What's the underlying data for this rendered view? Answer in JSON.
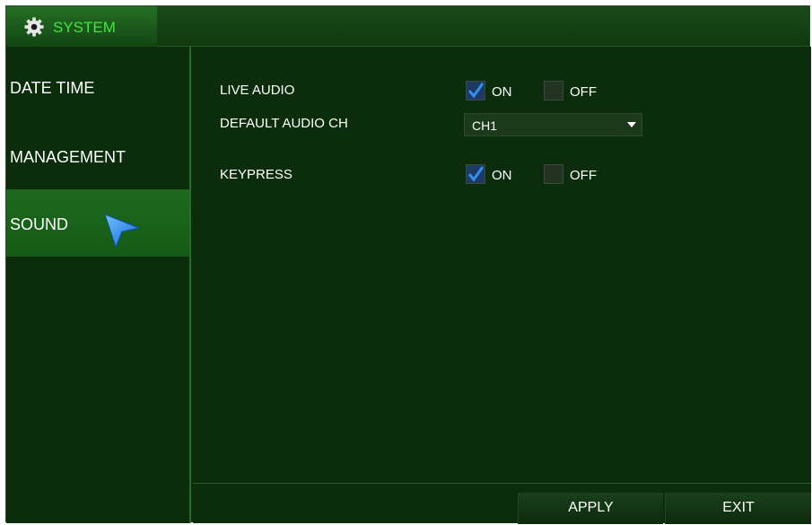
{
  "window": {
    "title": "SYSTEM",
    "title_icon": "gear-icon"
  },
  "sidebar": {
    "items": [
      {
        "label": "DATE TIME"
      },
      {
        "label": "MANAGEMENT"
      },
      {
        "label": "SOUND",
        "selected": true
      }
    ]
  },
  "content": {
    "live_audio": {
      "label": "LIVE AUDIO",
      "on_label": "ON",
      "off_label": "OFF",
      "value": "ON"
    },
    "default_audio_ch": {
      "label": "DEFAULT AUDIO CH",
      "value": "CH1"
    },
    "keypress": {
      "label": "KEYPRESS",
      "on_label": "ON",
      "off_label": "OFF",
      "value": "ON"
    }
  },
  "footer": {
    "apply_label": "APPLY",
    "exit_label": "EXIT"
  },
  "colors": {
    "background": "#0b2d0b",
    "title_text": "#3ee63e",
    "check_accent": "#2f8ef0",
    "cursor": "#1e90ff"
  }
}
